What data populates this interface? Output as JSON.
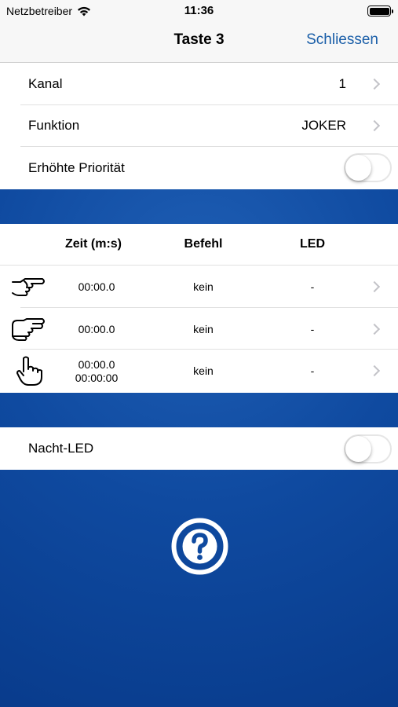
{
  "status_bar": {
    "carrier": "Netzbetreiber",
    "time": "11:36"
  },
  "nav": {
    "title": "Taste 3",
    "close_label": "Schliessen"
  },
  "settings": {
    "kanal": {
      "label": "Kanal",
      "value": "1"
    },
    "funktion": {
      "label": "Funktion",
      "value": "JOKER"
    },
    "priority": {
      "label": "Erhöhte Priorität",
      "on": false
    }
  },
  "timing_table": {
    "headers": {
      "zeit": "Zeit (m:s)",
      "befehl": "Befehl",
      "led": "LED"
    },
    "rows": [
      {
        "icon": "hand-point-right-icon",
        "time": "00:00.0",
        "command": "kein",
        "led": "-"
      },
      {
        "icon": "hand-double-point-icon",
        "time": "00:00.0",
        "command": "kein",
        "led": "-"
      },
      {
        "icon": "hand-press-icon",
        "time": "00:00.0",
        "time2": "00:00:00",
        "command": "kein",
        "led": "-"
      }
    ]
  },
  "night_led": {
    "label": "Nacht-LED",
    "on": false
  },
  "help": {
    "icon": "help-circle-icon"
  },
  "colors": {
    "accent": "#1a5ea8",
    "background_blue": "#0f4aa0"
  }
}
